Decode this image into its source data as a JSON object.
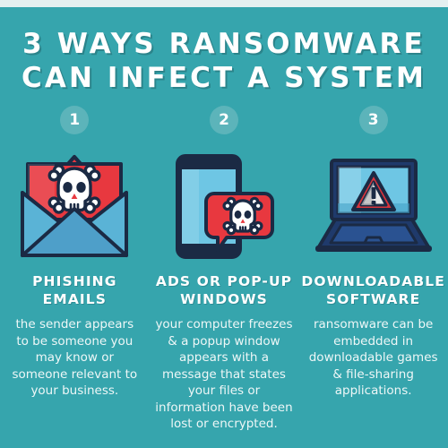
{
  "theme": {
    "background": "#36a5ad",
    "top_band": "#e4f0f0",
    "badge_fill": "#5cb4ba",
    "text_white": "#ffffff",
    "body_text": "#eef7f7",
    "alert_red": "#e8383f",
    "outline_navy": "#1b2a44",
    "screen_blue": "#6ec6e4",
    "envelope_blue": "#4e9fc9"
  },
  "title": {
    "line1": "3 WAYS RANSOMWARE",
    "line2": "CAN INFECT A SYSTEM"
  },
  "columns": [
    {
      "number": "1",
      "icon": "envelope-skull-icon",
      "heading": "PHISHING EMAILS",
      "body": "the sender appears to be someone you may know or someone relevant to your business."
    },
    {
      "number": "2",
      "icon": "smartphone-popup-skull-icon",
      "heading": "ADS OR POP-UP WINDOWS",
      "body": "your computer freezes & a popup window appears with a message that states your files or information have been lost or encrypted."
    },
    {
      "number": "3",
      "icon": "laptop-warning-icon",
      "heading": "DOWNLOADABLE SOFTWARE",
      "body": "ransomware can be embedded in downloadable games & file-sharing applications."
    }
  ]
}
